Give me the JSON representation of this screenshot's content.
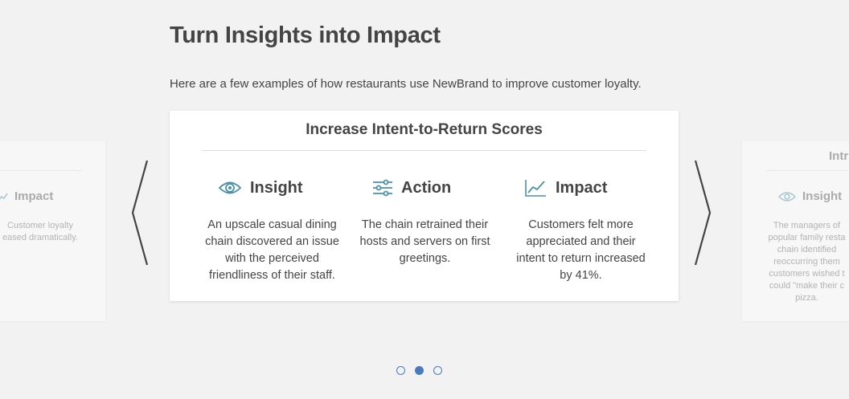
{
  "header": {
    "title": "Turn Insights into Impact",
    "intro": "Here are a few examples of how restaurants use NewBrand to improve customer loyalty."
  },
  "main_card": {
    "title": "Increase Intent-to-Return Scores",
    "columns": [
      {
        "icon": "eye-icon",
        "label": "Insight",
        "text": "An upscale casual dining chain discovered an issue with the perceived friendliness of their staff."
      },
      {
        "icon": "sliders-icon",
        "label": "Action",
        "text": "The chain retrained their hosts and servers on first greetings."
      },
      {
        "icon": "line-chart-icon",
        "label": "Impact",
        "text": "Customers felt more appreciated and their intent to return increased by 41%."
      }
    ]
  },
  "left_card": {
    "label": "Impact",
    "text_line1": "Customer loyalty",
    "text_line2": "eased dramatically."
  },
  "right_card": {
    "title": "Intr",
    "label": "Insight",
    "text": "The managers of popular family resta chain identified reoccurring them customers wished t could \"make their c pizza."
  },
  "pagination": {
    "total": 3,
    "active_index": 1
  },
  "colors": {
    "accent": "#4a7bbf",
    "icon_teal": "#4a90a8",
    "background": "#f2f2f2"
  }
}
